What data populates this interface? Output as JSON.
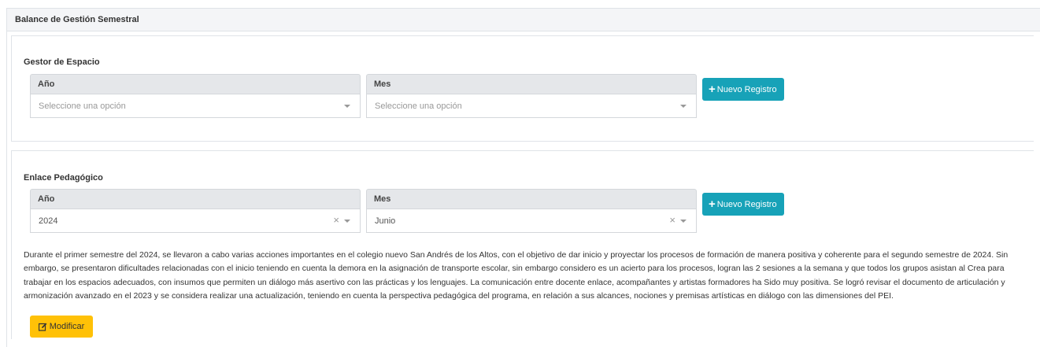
{
  "page": {
    "title": "Balance de Gestión Semestral"
  },
  "gestor": {
    "title": "Gestor de Espacio",
    "year_label": "Año",
    "year_placeholder": "Seleccione una opción",
    "month_label": "Mes",
    "month_placeholder": "Seleccione una opción",
    "new_button": "Nuevo Registro"
  },
  "enlace": {
    "title": "Enlace Pedagógico",
    "year_label": "Año",
    "year_value": "2024",
    "month_label": "Mes",
    "month_value": "Junio",
    "new_button": "Nuevo Registro",
    "description": "Durante el primer semestre del 2024, se llevaron a cabo varias acciones importantes en el colegio nuevo San Andrés de los Altos, con el objetivo de dar inicio y proyectar los procesos de formación de manera positiva y coherente para el segundo semestre de 2024. Sin embargo, se presentaron dificultades relacionadas con el inicio teniendo en cuenta la demora en la asignación de transporte escolar, sin embargo considero es un acierto para los procesos, logran las 2 sesiones a la semana y que todos los grupos asistan al Crea para trabajar en los espacios adecuados, con insumos que permiten un diálogo más asertivo con las prácticas y los lenguajes. La comunicación entre docente enlace, acompañantes y artistas formadores ha Sido muy positiva. Se logró revisar el documento de articulación y armonización avanzado en el 2023 y se considera realizar una actualización, teniendo en cuenta la perspectiva pedagógica del programa, en relación a sus alcances, nociones y premisas artísticas en diálogo con las dimensiones del PEI.",
    "modify_button": "Modificar"
  },
  "icons": {
    "plus": "plus-icon",
    "edit": "edit-icon",
    "caret": "chevron-down-icon",
    "clear": "close-icon"
  },
  "colors": {
    "primary_button": "#17a2b8",
    "warning_button": "#ffc107",
    "label_bg": "#e5e7ea"
  }
}
